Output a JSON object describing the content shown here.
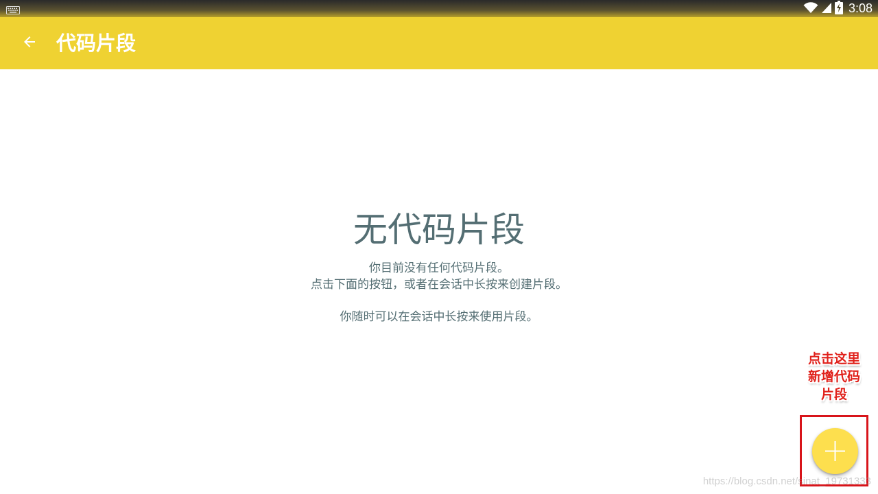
{
  "status_bar": {
    "time": "3:08",
    "icons": [
      "keyboard-icon",
      "wifi-icon",
      "signal-icon",
      "battery-charging-icon"
    ]
  },
  "toolbar": {
    "back_icon": "arrow-back-icon",
    "title": "代码片段",
    "color": "#efd232"
  },
  "empty_state": {
    "title": "无代码片段",
    "line1": "你目前没有任何代码片段。",
    "line2": "点击下面的按钮，或者在会话中长按来创建片段。",
    "line3": "你随时可以在会话中长按来使用片段。",
    "text_color": "#546e73"
  },
  "annotation": {
    "lines": [
      "点击这里",
      "新增代码",
      "片段"
    ],
    "color": "#e0201a"
  },
  "fab": {
    "icon": "plus-icon",
    "color": "#fddf4e"
  },
  "watermark": "https://blog.csdn.net/sinat_19731333"
}
